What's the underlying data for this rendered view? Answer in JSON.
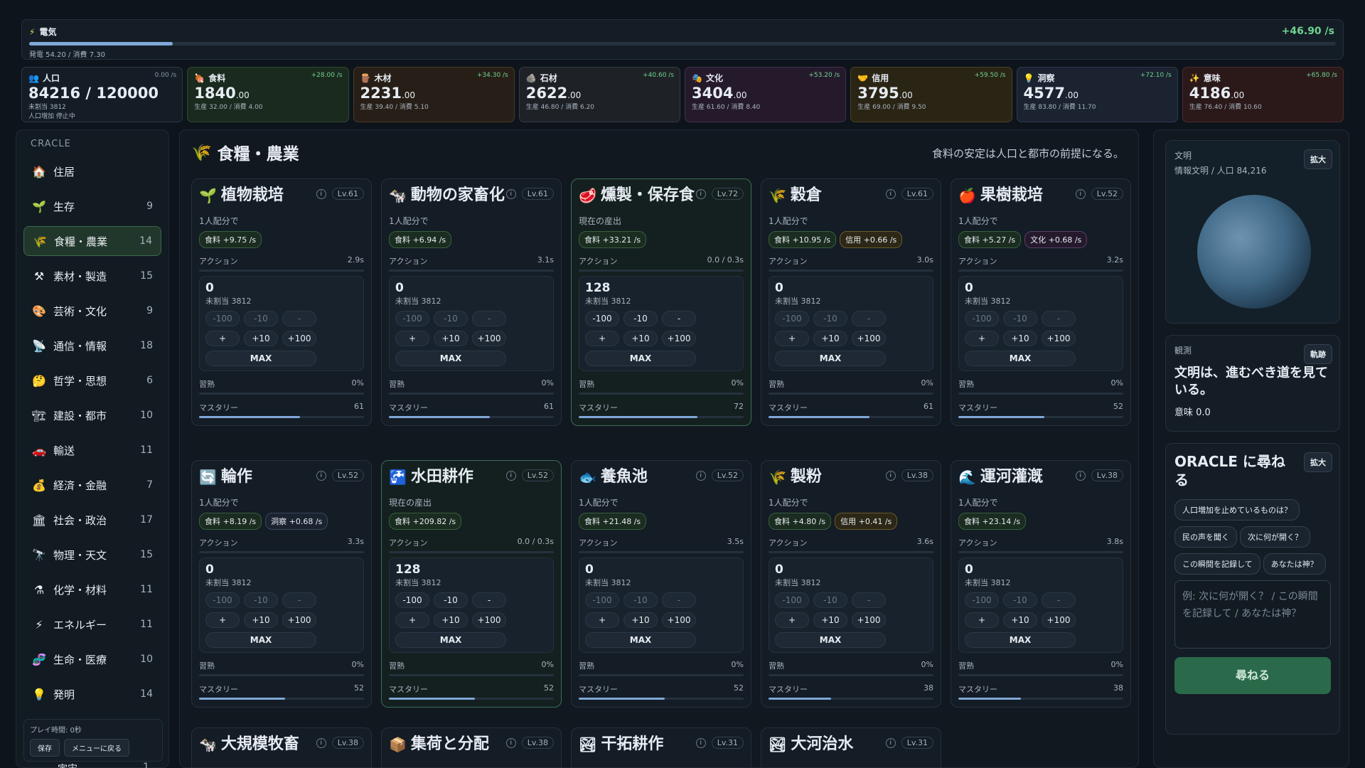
{
  "energy": {
    "label": "電気",
    "rate": "+46.90 /s",
    "sub": "発電 54.20 / 消費 7.30",
    "fill": 0.11
  },
  "resources": [
    {
      "icon": "👥",
      "name": "人口",
      "delta": "0.00 /s",
      "value": "84216 / 120000",
      "dec": "",
      "sub1": "未割当 3812",
      "sub2": "人口増加 停止中"
    },
    {
      "icon": "🍖",
      "name": "食料",
      "delta": "+28.00 /s",
      "value": "1840",
      "dec": ".00",
      "sub1": "生産 32.00 / 消費 4.00",
      "sub2": ""
    },
    {
      "icon": "🪵",
      "name": "木材",
      "delta": "+34.30 /s",
      "value": "2231",
      "dec": ".00",
      "sub1": "生産 39.40 / 消費 5.10",
      "sub2": ""
    },
    {
      "icon": "🪨",
      "name": "石材",
      "delta": "+40.60 /s",
      "value": "2622",
      "dec": ".00",
      "sub1": "生産 46.80 / 消費 6.20",
      "sub2": ""
    },
    {
      "icon": "🎭",
      "name": "文化",
      "delta": "+53.20 /s",
      "value": "3404",
      "dec": ".00",
      "sub1": "生産 61.60 / 消費 8.40",
      "sub2": ""
    },
    {
      "icon": "🤝",
      "name": "信用",
      "delta": "+59.50 /s",
      "value": "3795",
      "dec": ".00",
      "sub1": "生産 69.00 / 消費 9.50",
      "sub2": ""
    },
    {
      "icon": "💡",
      "name": "洞察",
      "delta": "+72.10 /s",
      "value": "4577",
      "dec": ".00",
      "sub1": "生産 83.80 / 消費 11.70",
      "sub2": ""
    },
    {
      "icon": "✨",
      "name": "意味",
      "delta": "+65.80 /s",
      "value": "4186",
      "dec": ".00",
      "sub1": "生産 76.40 / 消費 10.60",
      "sub2": ""
    }
  ],
  "sidebar": {
    "brand": "CRACLE",
    "items": [
      {
        "icon": "🏠",
        "label": "住居",
        "count": ""
      },
      {
        "icon": "🌱",
        "label": "生存",
        "count": "9"
      },
      {
        "icon": "🌾",
        "label": "食糧・農業",
        "count": "14"
      },
      {
        "icon": "⚒",
        "label": "素材・製造",
        "count": "15"
      },
      {
        "icon": "🎨",
        "label": "芸術・文化",
        "count": "9"
      },
      {
        "icon": "📡",
        "label": "通信・情報",
        "count": "18"
      },
      {
        "icon": "🤔",
        "label": "哲学・思想",
        "count": "6"
      },
      {
        "icon": "🏗",
        "label": "建設・都市",
        "count": "10"
      },
      {
        "icon": "🚗",
        "label": "輸送",
        "count": "11"
      },
      {
        "icon": "💰",
        "label": "経済・金融",
        "count": "7"
      },
      {
        "icon": "🏛",
        "label": "社会・政治",
        "count": "17"
      },
      {
        "icon": "🔭",
        "label": "物理・天文",
        "count": "15"
      },
      {
        "icon": "⚗",
        "label": "化学・材料",
        "count": "11"
      },
      {
        "icon": "⚡",
        "label": "エネルギー",
        "count": "11"
      },
      {
        "icon": "🧬",
        "label": "生命・医療",
        "count": "10"
      },
      {
        "icon": "💡",
        "label": "発明",
        "count": "14"
      }
    ],
    "playtime": "プレイ時間: 0秒",
    "save": "保存",
    "menu": "メニューに戻る",
    "peek_label": "宇宙",
    "peek_count": "1"
  },
  "main": {
    "title": "食糧・農業",
    "hint": "食料の安定は人口と都市の前提になる。",
    "cards": [
      {
        "icon": "🌱",
        "title": "植物栽培",
        "lv": "Lv.61",
        "prod_label": "1人配分で",
        "chips": [
          {
            "t": "食料 +9.75 /s",
            "c": "food"
          }
        ],
        "act_time": "2.9s",
        "alloc": "0",
        "unalloc": "未割当 3812",
        "habit": "0%",
        "mastery": "61",
        "mastery_frac": 0.61,
        "hl": false
      },
      {
        "icon": "🐄",
        "title": "動物の家畜化",
        "lv": "Lv.61",
        "prod_label": "1人配分で",
        "chips": [
          {
            "t": "食料 +6.94 /s",
            "c": "food"
          }
        ],
        "act_time": "3.1s",
        "alloc": "0",
        "unalloc": "未割当 3812",
        "habit": "0%",
        "mastery": "61",
        "mastery_frac": 0.61,
        "hl": false
      },
      {
        "icon": "🥩",
        "title": "燻製・保存食",
        "lv": "Lv.72",
        "prod_label": "現在の産出",
        "chips": [
          {
            "t": "食料 +33.21 /s",
            "c": "food"
          }
        ],
        "act_time": "0.0 / 0.3s",
        "alloc": "128",
        "unalloc": "未割当 3812",
        "habit": "0%",
        "mastery": "72",
        "mastery_frac": 0.72,
        "hl": true
      },
      {
        "icon": "🌾",
        "title": "穀倉",
        "lv": "Lv.61",
        "prod_label": "1人配分で",
        "chips": [
          {
            "t": "食料 +10.95 /s",
            "c": "food"
          },
          {
            "t": "信用 +0.66 /s",
            "c": "credit"
          }
        ],
        "act_time": "3.0s",
        "alloc": "0",
        "unalloc": "未割当 3812",
        "habit": "0%",
        "mastery": "61",
        "mastery_frac": 0.61,
        "hl": false
      },
      {
        "icon": "🍎",
        "title": "果樹栽培",
        "lv": "Lv.52",
        "prod_label": "1人配分で",
        "chips": [
          {
            "t": "食料 +5.27 /s",
            "c": "food"
          },
          {
            "t": "文化 +0.68 /s",
            "c": "culture"
          }
        ],
        "act_time": "3.2s",
        "alloc": "0",
        "unalloc": "未割当 3812",
        "habit": "0%",
        "mastery": "52",
        "mastery_frac": 0.52,
        "hl": false
      },
      {
        "icon": "🔄",
        "title": "輪作",
        "lv": "Lv.52",
        "prod_label": "1人配分で",
        "chips": [
          {
            "t": "食料 +8.19 /s",
            "c": "food"
          },
          {
            "t": "洞察 +0.68 /s",
            "c": "insight"
          }
        ],
        "act_time": "3.3s",
        "alloc": "0",
        "unalloc": "未割当 3812",
        "habit": "0%",
        "mastery": "52",
        "mastery_frac": 0.52,
        "hl": false
      },
      {
        "icon": "🚰",
        "title": "水田耕作",
        "lv": "Lv.52",
        "prod_label": "現在の産出",
        "chips": [
          {
            "t": "食料 +209.82 /s",
            "c": "food"
          }
        ],
        "act_time": "0.0 / 0.3s",
        "alloc": "128",
        "unalloc": "未割当 3812",
        "habit": "0%",
        "mastery": "52",
        "mastery_frac": 0.52,
        "hl": true
      },
      {
        "icon": "🐟",
        "title": "養魚池",
        "lv": "Lv.52",
        "prod_label": "1人配分で",
        "chips": [
          {
            "t": "食料 +21.48 /s",
            "c": "food"
          }
        ],
        "act_time": "3.5s",
        "alloc": "0",
        "unalloc": "未割当 3812",
        "habit": "0%",
        "mastery": "52",
        "mastery_frac": 0.52,
        "hl": false
      },
      {
        "icon": "🌾",
        "title": "製粉",
        "lv": "Lv.38",
        "prod_label": "1人配分で",
        "chips": [
          {
            "t": "食料 +4.80 /s",
            "c": "food"
          },
          {
            "t": "信用 +0.41 /s",
            "c": "credit"
          }
        ],
        "act_time": "3.6s",
        "alloc": "0",
        "unalloc": "未割当 3812",
        "habit": "0%",
        "mastery": "38",
        "mastery_frac": 0.38,
        "hl": false
      },
      {
        "icon": "🌊",
        "title": "運河灌漑",
        "lv": "Lv.38",
        "prod_label": "1人配分で",
        "chips": [
          {
            "t": "食料 +23.14 /s",
            "c": "food"
          }
        ],
        "act_time": "3.8s",
        "alloc": "0",
        "unalloc": "未割当 3812",
        "habit": "0%",
        "mastery": "38",
        "mastery_frac": 0.38,
        "hl": false
      }
    ],
    "row3": [
      {
        "icon": "🐄",
        "title": "大規模牧畜",
        "lv": "Lv.38"
      },
      {
        "icon": "📦",
        "title": "集荷と分配",
        "lv": "Lv.38"
      },
      {
        "icon": "🏞",
        "title": "干拓耕作",
        "lv": "Lv.31"
      },
      {
        "icon": "🏞",
        "title": "大河治水",
        "lv": "Lv.31"
      }
    ],
    "labels": {
      "action": "アクション",
      "habit": "習熟",
      "mastery": "マスタリー",
      "max": "MAX",
      "m100": "-100",
      "m10": "-10",
      "m1": "-",
      "p1": "+",
      "p10": "+10",
      "p100": "+100"
    }
  },
  "right": {
    "civ_label": "文明",
    "civ_sub": "情報文明 / 人口 84,216",
    "expand": "拡大",
    "obs_label": "観測",
    "obs_btn": "軌跡",
    "obs_text": "文明は、進むべき道を見ている。",
    "obs_meaning": "意味 0.0",
    "oracle_title": "ORACLE に尋ねる",
    "oracle_expand": "拡大",
    "questions": [
      "人口増加を止めているものは？",
      "民の声を聞く",
      "次に何が開く？",
      "この瞬間を記録して",
      "あなたは神？"
    ],
    "placeholder": "例: 次に何が開く？ / この瞬間を記録して / あなたは神？",
    "ask": "尋ねる"
  }
}
